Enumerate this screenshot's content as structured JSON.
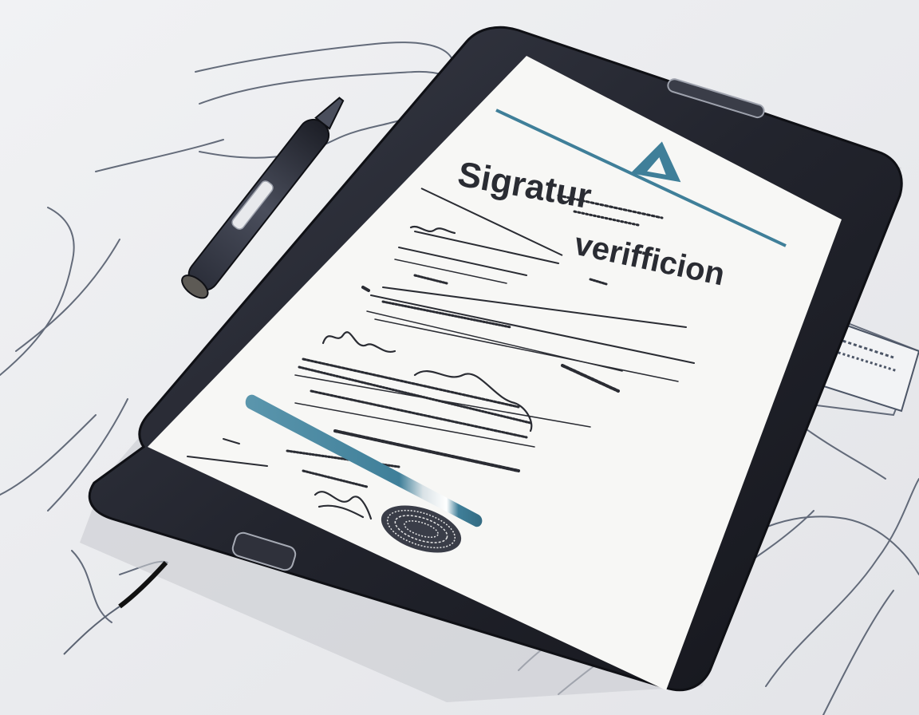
{
  "document": {
    "title_part1": "Sigratur",
    "title_part2": "verifficion"
  },
  "colors": {
    "background": "#e9eaed",
    "device_body": "#23252f",
    "screen": "#f7f7f5",
    "accent": "#3f7f99",
    "ink": "#2a2c33"
  },
  "icons": {
    "logo": "triangle-logo-icon",
    "stylus": "stylus-pen",
    "seal": "fingerprint-seal-icon"
  }
}
